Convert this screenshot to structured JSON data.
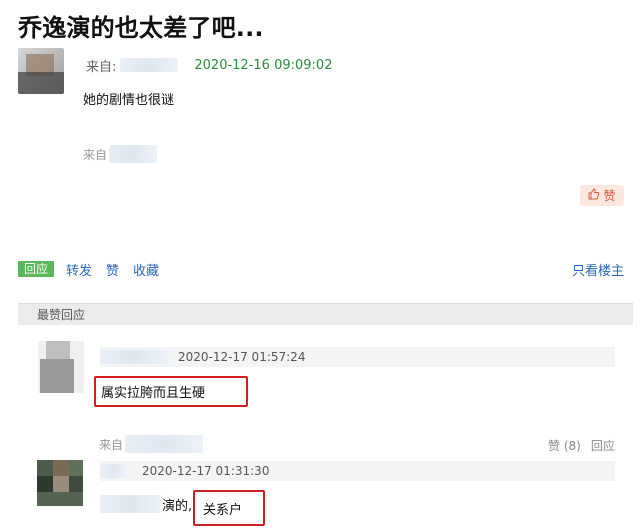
{
  "post": {
    "title": "乔逸演的也太差了吧...",
    "meta_label": "来自:",
    "time": "2020-12-16 09:09:02",
    "text": "她的剧情也很谜",
    "source_label": "来自",
    "like_label": "赞"
  },
  "actions": {
    "reply": "回应",
    "repost": "转发",
    "like": "赞",
    "collect": "收藏",
    "only_author": "只看楼主"
  },
  "best_replies": {
    "header": "最赞回应",
    "items": [
      {
        "time": "2020-12-17 01:57:24",
        "text": "属实拉胯而且生硬"
      },
      {
        "source_label": "来自",
        "likes": "赞 (8)",
        "reply": "回应",
        "time": "2020-12-17 01:31:30",
        "text_prefix": "演的,",
        "text_boxed": "关系户"
      }
    ]
  },
  "colors": {
    "timestamp": "#2c8a3e",
    "link": "#2c67b7",
    "reply_button": "#5cb85c",
    "highlight_box": "#d01f1f"
  }
}
